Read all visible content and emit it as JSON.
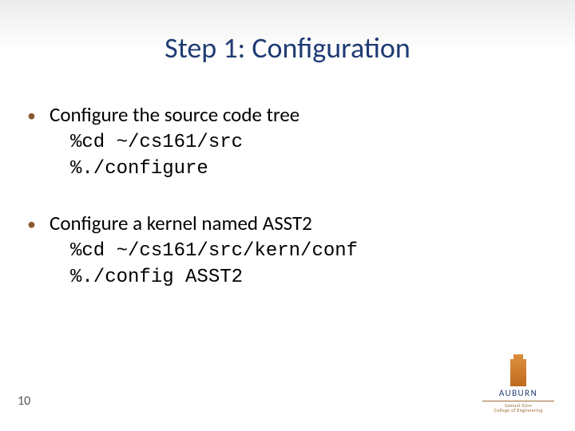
{
  "title": "Step 1: Configuration",
  "bullets": [
    {
      "text": "Configure the source code tree",
      "code": [
        "%cd ~/cs161/src",
        "%./configure"
      ]
    },
    {
      "text": "Configure a kernel named ASST2",
      "code": [
        "%cd ~/cs161/src/kern/conf",
        "%./config ASST2"
      ]
    }
  ],
  "page_number": "10",
  "logo": {
    "name": "AUBURN",
    "sub1": "Samuel Ginn",
    "sub2": "College of Engineering"
  }
}
